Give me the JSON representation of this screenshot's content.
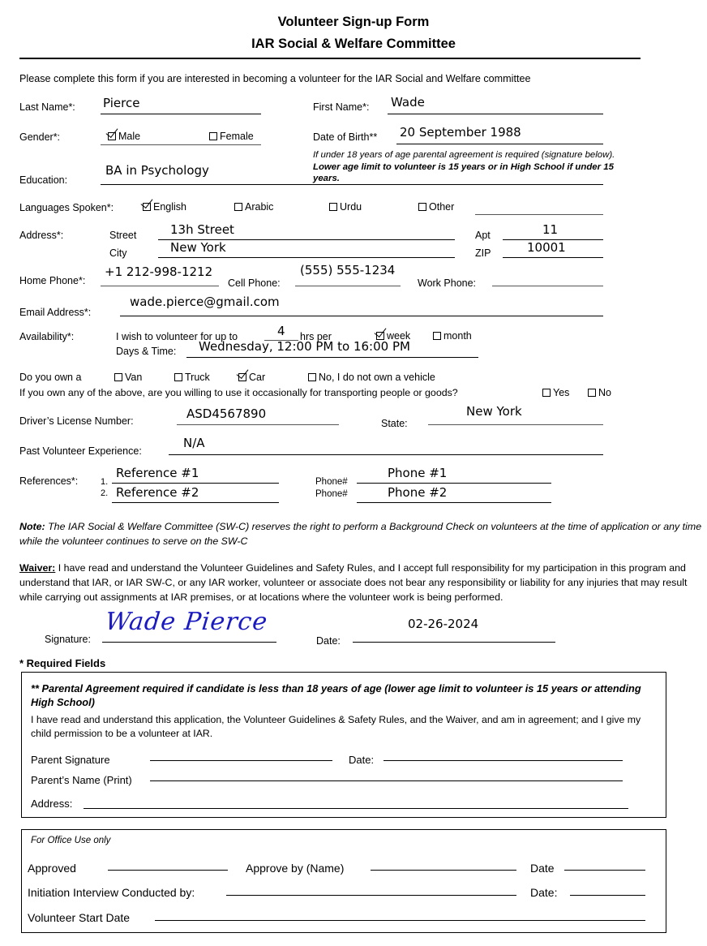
{
  "header": {
    "title_line1": "Volunteer Sign-up Form",
    "title_line2": "IAR Social & Welfare Committee",
    "intro": "Please complete this form if you are interested in becoming a volunteer for the IAR Social and Welfare committee"
  },
  "name": {
    "last_label": "Last Name*:",
    "last_value": "Pierce",
    "first_label": "First Name*:",
    "first_value": "Wade"
  },
  "gender": {
    "label": "Gender*:",
    "options": [
      {
        "label": "Male",
        "checked": true
      },
      {
        "label": "Female",
        "checked": false
      }
    ]
  },
  "dob": {
    "label": "Date of Birth**",
    "value": "20 September 1988",
    "note_plain": "If under 18 years of age parental agreement is required (signature below). ",
    "note_bold": "Lower age limit to volunteer is 15 years or in High School if under 15 years."
  },
  "education": {
    "label": "Education:",
    "value": "BA in Psychology"
  },
  "languages": {
    "label": "Languages Spoken*:",
    "options": [
      {
        "label": "English",
        "checked": true
      },
      {
        "label": "Arabic",
        "checked": false
      },
      {
        "label": "Urdu",
        "checked": false
      },
      {
        "label": "Other",
        "checked": false
      }
    ],
    "other_value": ""
  },
  "address": {
    "label": "Address*:",
    "street_label": "Street",
    "street_value": "13h Street",
    "city_label": "City",
    "city_value": "New York",
    "apt_label": "Apt",
    "apt_value": "11",
    "zip_label": "ZIP",
    "zip_value": "10001"
  },
  "phones": {
    "home_label": "Home Phone*:",
    "home_value": "+1 212-998-1212",
    "cell_label": "Cell Phone:",
    "cell_value": "(555) 555-1234",
    "work_label": "Work Phone:",
    "work_value": ""
  },
  "email": {
    "label": "Email Address*:",
    "value": "wade.pierce@gmail.com"
  },
  "availability": {
    "label": "Availability*:",
    "lead": "I wish to volunteer for up to",
    "hours_value": "4",
    "hrs_per": "hrs per",
    "period_options": [
      {
        "label": "week",
        "checked": true
      },
      {
        "label": "month",
        "checked": false
      }
    ],
    "days_label": "Days & Time:",
    "days_value": "Wednesday, 12:00 PM to 16:00 PM"
  },
  "vehicle": {
    "label": "Do you own a",
    "options": [
      {
        "label": "Van",
        "checked": false
      },
      {
        "label": "Truck",
        "checked": false
      },
      {
        "label": "Car",
        "checked": true
      },
      {
        "label": "No, I do not own a vehicle",
        "checked": false
      }
    ],
    "willing_question": "If you own any of the above, are you willing to use it occasionally for transporting people or goods?",
    "willing_options": [
      {
        "label": "Yes",
        "checked": false
      },
      {
        "label": "No",
        "checked": false
      }
    ]
  },
  "license": {
    "label": "Driver’s License Number:",
    "value": "ASD4567890",
    "state_label": "State:",
    "state_value": "New York"
  },
  "experience": {
    "label": "Past Volunteer Experience:",
    "value": "N/A"
  },
  "references": {
    "label": "References*:",
    "rows": [
      {
        "num": "1.",
        "name": "Reference #1",
        "phone_label": "Phone#",
        "phone": "Phone #1"
      },
      {
        "num": "2.",
        "name": "Reference #2",
        "phone_label": "Phone#",
        "phone": "Phone #2"
      }
    ]
  },
  "note": {
    "heading": "Note:",
    "text": " The IAR Social & Welfare Committee (SW-C) reserves the right to perform a Background Check on volunteers at the time of application or any time while the volunteer continues to serve on the SW-C"
  },
  "waiver": {
    "heading": "Waiver:",
    "text": " I have read and understand the Volunteer Guidelines and Safety Rules, and I accept full responsibility for my participation in this program and understand that IAR, or IAR SW-C, or any IAR worker, volunteer or associate does not bear any responsibility or liability for any injuries that may result while carrying out assignments at IAR premises, or at locations where the volunteer work is being performed."
  },
  "signature": {
    "label": "Signature:",
    "value": "Wade Pierce",
    "date_label": "Date:",
    "date_value": "02-26-2024",
    "ink_color": "#1a1ac0"
  },
  "required_fields_note": "* Required Fields",
  "parental": {
    "heading": "** Parental Agreement required if candidate is less than 18 years of age (lower age limit to volunteer is 15 years or attending High School)",
    "body": "I have read and understand this application, the Volunteer Guidelines & Safety Rules, and the Waiver, and am in agreement; and I give my child permission to be a volunteer at IAR.",
    "parent_signature_label": "Parent Signature",
    "date_label": "Date:",
    "parent_name_label": "Parent’s Name (Print)",
    "address_label": "Address:"
  },
  "office": {
    "heading": "For Office Use only",
    "approved_label": "Approved",
    "approve_by_label": "Approve by (Name)",
    "date_label": "Date",
    "interview_label": "Initiation Interview Conducted by:",
    "interview_date_label": "Date:",
    "start_date_label": "Volunteer Start Date"
  }
}
